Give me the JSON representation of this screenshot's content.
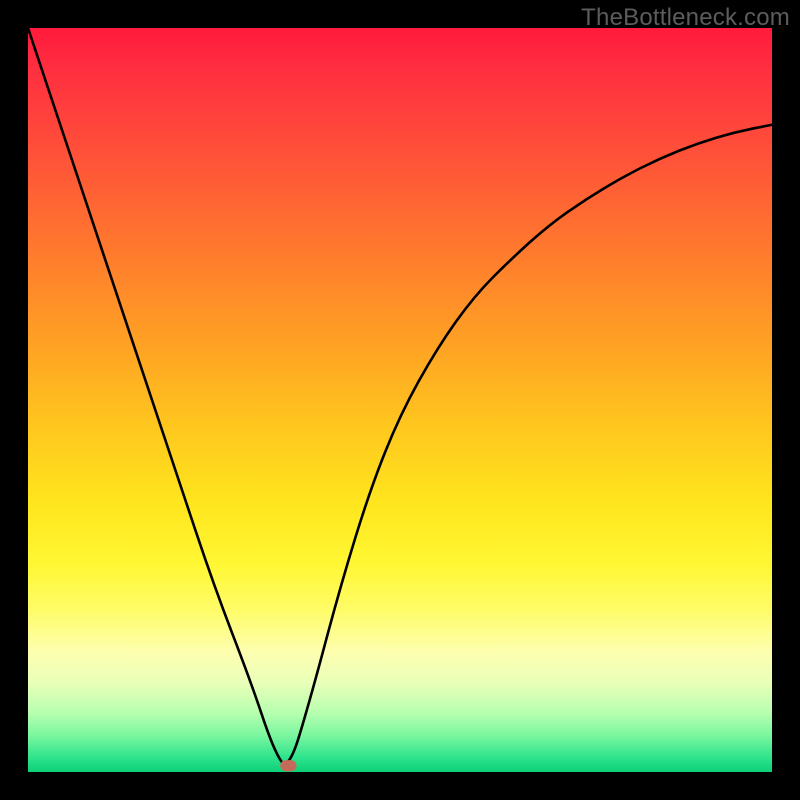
{
  "watermark": "TheBottleneck.com",
  "chart_data": {
    "type": "line",
    "title": "",
    "xlabel": "",
    "ylabel": "",
    "xlim": [
      0,
      100
    ],
    "ylim": [
      0,
      100
    ],
    "grid": false,
    "legend": false,
    "series": [
      {
        "name": "curve",
        "x": [
          0,
          5,
          10,
          15,
          20,
          25,
          30,
          33,
          35,
          38,
          42,
          46,
          50,
          55,
          60,
          65,
          70,
          75,
          80,
          85,
          90,
          95,
          100
        ],
        "values": [
          100,
          85,
          70,
          55,
          40,
          25,
          12,
          3,
          0,
          10,
          25,
          38,
          48,
          57,
          64,
          69,
          73.5,
          77,
          80,
          82.5,
          84.5,
          86,
          87
        ]
      }
    ],
    "marker": {
      "x": 35,
      "y": 0,
      "color": "#c46a5a"
    },
    "background_gradient": {
      "top": "#ff1a3c",
      "mid": "#ffe61e",
      "bottom": "#0cd078"
    }
  }
}
